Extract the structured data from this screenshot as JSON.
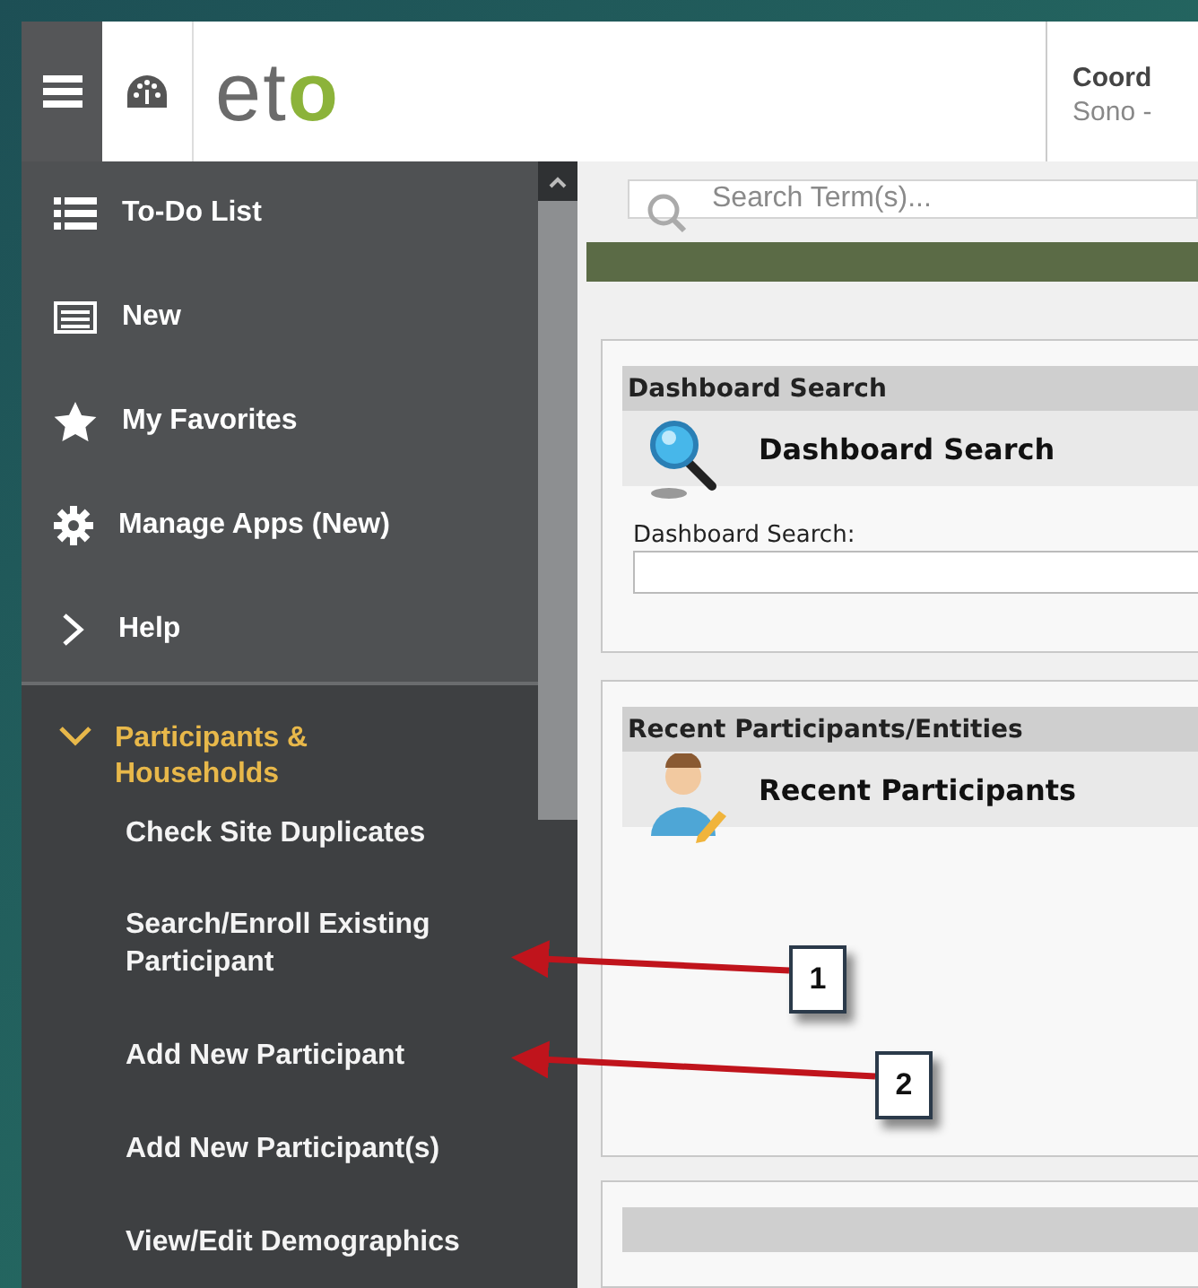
{
  "header": {
    "logo": "eto",
    "user": {
      "name": "Coord",
      "site": "Sono -"
    }
  },
  "sidebar": {
    "items": [
      {
        "label": "To-Do List"
      },
      {
        "label": "New"
      },
      {
        "label": "My Favorites"
      },
      {
        "label": "Manage Apps (New)"
      },
      {
        "label": "Help"
      }
    ],
    "section": {
      "label": "Participants & Households",
      "expanded": true,
      "children": [
        {
          "label": "Check Site Duplicates"
        },
        {
          "label": "Search/Enroll Existing Participant"
        },
        {
          "label": "Add New Participant"
        },
        {
          "label": "Add New Participant(s)"
        },
        {
          "label": "View/Edit Demographics"
        }
      ]
    }
  },
  "search": {
    "placeholder": "Search Term(s)..."
  },
  "panels": [
    {
      "kind": "search",
      "header": "Dashboard Search",
      "title": "Dashboard Search",
      "field_label": "Dashboard Search:"
    },
    {
      "kind": "recent",
      "header": "Recent Participants/Entities",
      "title": "Recent Participants"
    },
    {
      "kind": "cut"
    }
  ],
  "callouts": [
    {
      "label": "1"
    },
    {
      "label": "2"
    }
  ]
}
